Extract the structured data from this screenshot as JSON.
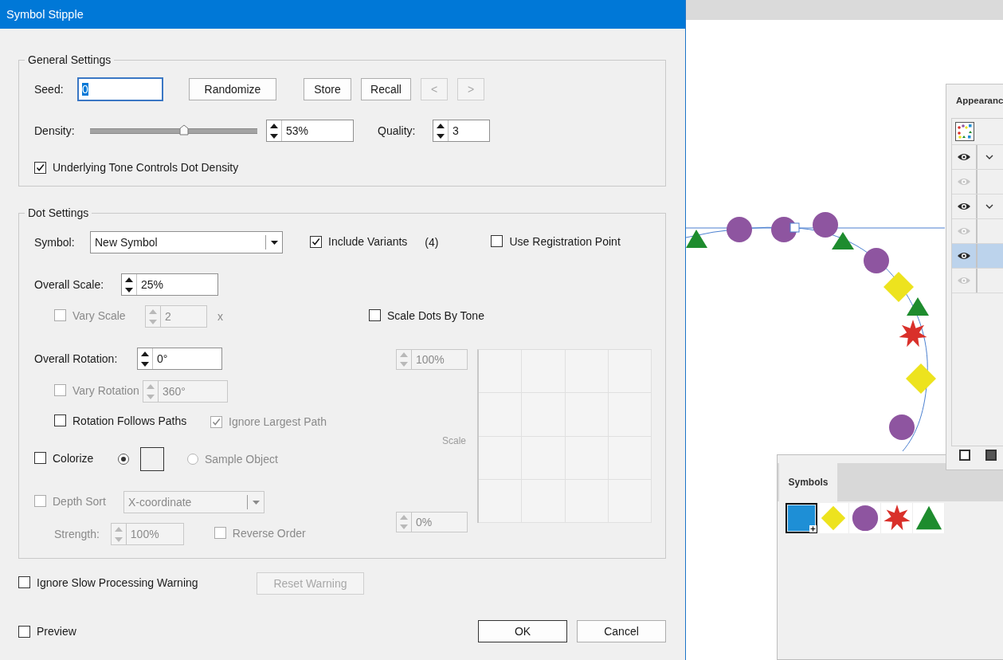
{
  "window": {
    "title": "Symbol Stipple"
  },
  "general_settings": {
    "title": "General Settings",
    "seed": {
      "label": "Seed:",
      "value": "0",
      "text_selected": true
    },
    "buttons": [
      {
        "label": "Randomize",
        "disabled": false
      },
      {
        "label": "Store",
        "disabled": false
      },
      {
        "label": "Recall",
        "disabled": false
      },
      {
        "label": "<",
        "disabled": true
      },
      {
        "label": ">",
        "disabled": true
      }
    ],
    "density": {
      "label": "Density:",
      "level": 0.56,
      "value": "53%"
    },
    "quality": {
      "label": "Quality:",
      "value": "3"
    },
    "tone_controls_density": {
      "label": "Underlying Tone Controls Dot Density",
      "checked": true
    }
  },
  "dot_settings": {
    "title": "Dot Settings",
    "symbol": {
      "label": "Symbol:",
      "value": "New Symbol"
    },
    "include_variants": {
      "label": "Include Variants",
      "checked": true,
      "count": "(4)"
    },
    "use_registration_point": {
      "label": "Use Registration Point",
      "checked": false
    },
    "overall_scale": {
      "label": "Overall Scale:",
      "value": "25%"
    },
    "vary_scale": {
      "label": "Vary Scale",
      "checked": false,
      "value": "2",
      "unit": "x",
      "disabled": true
    },
    "scale_dots_by_tone": {
      "label": "Scale Dots By Tone",
      "checked": false
    },
    "overall_rotation": {
      "label": "Overall Rotation:",
      "value": "0°"
    },
    "vary_rotation": {
      "label": "Vary Rotation",
      "checked": false,
      "value": "360°",
      "disabled": true
    },
    "rotation_follows_paths": {
      "label": "Rotation Follows Paths",
      "checked": false
    },
    "ignore_largest_path": {
      "label": "Ignore Largest Path",
      "checked": true,
      "disabled": true
    },
    "colorize": {
      "label": "Colorize",
      "checked": false
    },
    "colorize_sources": [
      {
        "kind": "color",
        "selected": true,
        "disabled": false
      },
      {
        "kind": "sample",
        "label": "Sample Object",
        "selected": false,
        "disabled": true
      }
    ],
    "depth_sort": {
      "label": "Depth Sort",
      "checked": false,
      "value": "X-coordinate",
      "disabled": true
    },
    "strength": {
      "label": "Strength:",
      "value": "100%",
      "disabled": true
    },
    "reverse_order": {
      "label": "Reverse Order",
      "checked": false,
      "disabled": true
    },
    "scale_graph": {
      "label": "Scale",
      "top_value": "100%",
      "bottom_value": "0%",
      "disabled": true
    }
  },
  "ignore_slow_warning": {
    "label": "Ignore Slow Processing Warning",
    "checked": false
  },
  "reset_warning": {
    "label": "Reset Warning",
    "disabled": true
  },
  "preview": {
    "label": "Preview",
    "checked": false
  },
  "dialog_buttons": [
    {
      "label": "OK",
      "default": true
    },
    {
      "label": "Cancel",
      "default": false
    }
  ],
  "appearance_panel": {
    "title": "Appearanc",
    "rows": [
      {
        "visible": true,
        "expandable": true,
        "selected": false
      },
      {
        "visible": false,
        "expandable": false,
        "selected": false
      },
      {
        "visible": true,
        "expandable": true,
        "selected": false
      },
      {
        "visible": false,
        "expandable": false,
        "selected": false
      },
      {
        "visible": true,
        "expandable": false,
        "selected": true
      },
      {
        "visible": false,
        "expandable": false,
        "selected": false
      }
    ]
  },
  "symbols_panel": {
    "tab": "Symbols",
    "symbols": [
      {
        "kind": "square",
        "color": "#1e8fd6",
        "selected": true
      },
      {
        "kind": "diamond",
        "color": "#ede31e",
        "selected": false
      },
      {
        "kind": "circle",
        "color": "#8e55a0",
        "selected": false
      },
      {
        "kind": "star",
        "color": "#d9302a",
        "selected": false
      },
      {
        "kind": "triangle",
        "color": "#1e8c2e",
        "selected": false
      }
    ]
  }
}
